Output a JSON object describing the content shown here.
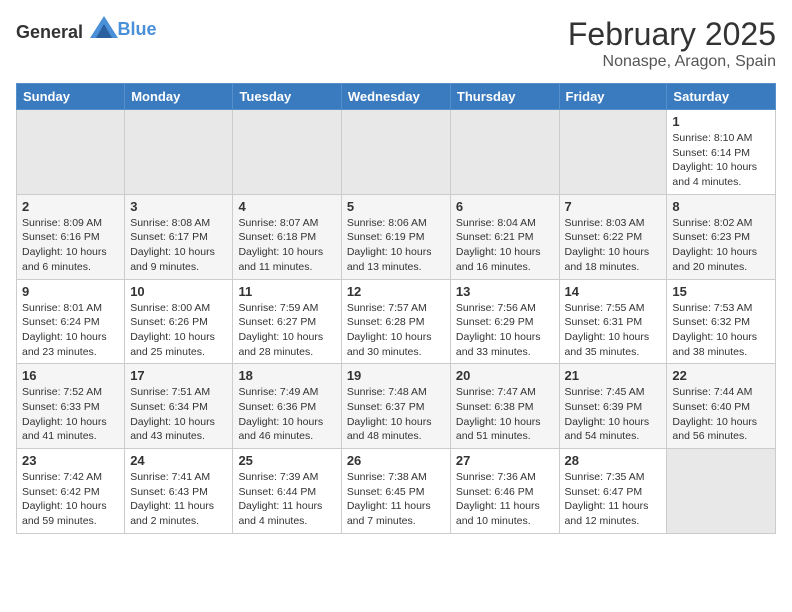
{
  "header": {
    "logo_general": "General",
    "logo_blue": "Blue",
    "month_year": "February 2025",
    "location": "Nonaspe, Aragon, Spain"
  },
  "weekdays": [
    "Sunday",
    "Monday",
    "Tuesday",
    "Wednesday",
    "Thursday",
    "Friday",
    "Saturday"
  ],
  "weeks": [
    [
      {
        "day": "",
        "info": ""
      },
      {
        "day": "",
        "info": ""
      },
      {
        "day": "",
        "info": ""
      },
      {
        "day": "",
        "info": ""
      },
      {
        "day": "",
        "info": ""
      },
      {
        "day": "",
        "info": ""
      },
      {
        "day": "1",
        "info": "Sunrise: 8:10 AM\nSunset: 6:14 PM\nDaylight: 10 hours and 4 minutes."
      }
    ],
    [
      {
        "day": "2",
        "info": "Sunrise: 8:09 AM\nSunset: 6:16 PM\nDaylight: 10 hours and 6 minutes."
      },
      {
        "day": "3",
        "info": "Sunrise: 8:08 AM\nSunset: 6:17 PM\nDaylight: 10 hours and 9 minutes."
      },
      {
        "day": "4",
        "info": "Sunrise: 8:07 AM\nSunset: 6:18 PM\nDaylight: 10 hours and 11 minutes."
      },
      {
        "day": "5",
        "info": "Sunrise: 8:06 AM\nSunset: 6:19 PM\nDaylight: 10 hours and 13 minutes."
      },
      {
        "day": "6",
        "info": "Sunrise: 8:04 AM\nSunset: 6:21 PM\nDaylight: 10 hours and 16 minutes."
      },
      {
        "day": "7",
        "info": "Sunrise: 8:03 AM\nSunset: 6:22 PM\nDaylight: 10 hours and 18 minutes."
      },
      {
        "day": "8",
        "info": "Sunrise: 8:02 AM\nSunset: 6:23 PM\nDaylight: 10 hours and 20 minutes."
      }
    ],
    [
      {
        "day": "9",
        "info": "Sunrise: 8:01 AM\nSunset: 6:24 PM\nDaylight: 10 hours and 23 minutes."
      },
      {
        "day": "10",
        "info": "Sunrise: 8:00 AM\nSunset: 6:26 PM\nDaylight: 10 hours and 25 minutes."
      },
      {
        "day": "11",
        "info": "Sunrise: 7:59 AM\nSunset: 6:27 PM\nDaylight: 10 hours and 28 minutes."
      },
      {
        "day": "12",
        "info": "Sunrise: 7:57 AM\nSunset: 6:28 PM\nDaylight: 10 hours and 30 minutes."
      },
      {
        "day": "13",
        "info": "Sunrise: 7:56 AM\nSunset: 6:29 PM\nDaylight: 10 hours and 33 minutes."
      },
      {
        "day": "14",
        "info": "Sunrise: 7:55 AM\nSunset: 6:31 PM\nDaylight: 10 hours and 35 minutes."
      },
      {
        "day": "15",
        "info": "Sunrise: 7:53 AM\nSunset: 6:32 PM\nDaylight: 10 hours and 38 minutes."
      }
    ],
    [
      {
        "day": "16",
        "info": "Sunrise: 7:52 AM\nSunset: 6:33 PM\nDaylight: 10 hours and 41 minutes."
      },
      {
        "day": "17",
        "info": "Sunrise: 7:51 AM\nSunset: 6:34 PM\nDaylight: 10 hours and 43 minutes."
      },
      {
        "day": "18",
        "info": "Sunrise: 7:49 AM\nSunset: 6:36 PM\nDaylight: 10 hours and 46 minutes."
      },
      {
        "day": "19",
        "info": "Sunrise: 7:48 AM\nSunset: 6:37 PM\nDaylight: 10 hours and 48 minutes."
      },
      {
        "day": "20",
        "info": "Sunrise: 7:47 AM\nSunset: 6:38 PM\nDaylight: 10 hours and 51 minutes."
      },
      {
        "day": "21",
        "info": "Sunrise: 7:45 AM\nSunset: 6:39 PM\nDaylight: 10 hours and 54 minutes."
      },
      {
        "day": "22",
        "info": "Sunrise: 7:44 AM\nSunset: 6:40 PM\nDaylight: 10 hours and 56 minutes."
      }
    ],
    [
      {
        "day": "23",
        "info": "Sunrise: 7:42 AM\nSunset: 6:42 PM\nDaylight: 10 hours and 59 minutes."
      },
      {
        "day": "24",
        "info": "Sunrise: 7:41 AM\nSunset: 6:43 PM\nDaylight: 11 hours and 2 minutes."
      },
      {
        "day": "25",
        "info": "Sunrise: 7:39 AM\nSunset: 6:44 PM\nDaylight: 11 hours and 4 minutes."
      },
      {
        "day": "26",
        "info": "Sunrise: 7:38 AM\nSunset: 6:45 PM\nDaylight: 11 hours and 7 minutes."
      },
      {
        "day": "27",
        "info": "Sunrise: 7:36 AM\nSunset: 6:46 PM\nDaylight: 11 hours and 10 minutes."
      },
      {
        "day": "28",
        "info": "Sunrise: 7:35 AM\nSunset: 6:47 PM\nDaylight: 11 hours and 12 minutes."
      },
      {
        "day": "",
        "info": ""
      }
    ]
  ]
}
